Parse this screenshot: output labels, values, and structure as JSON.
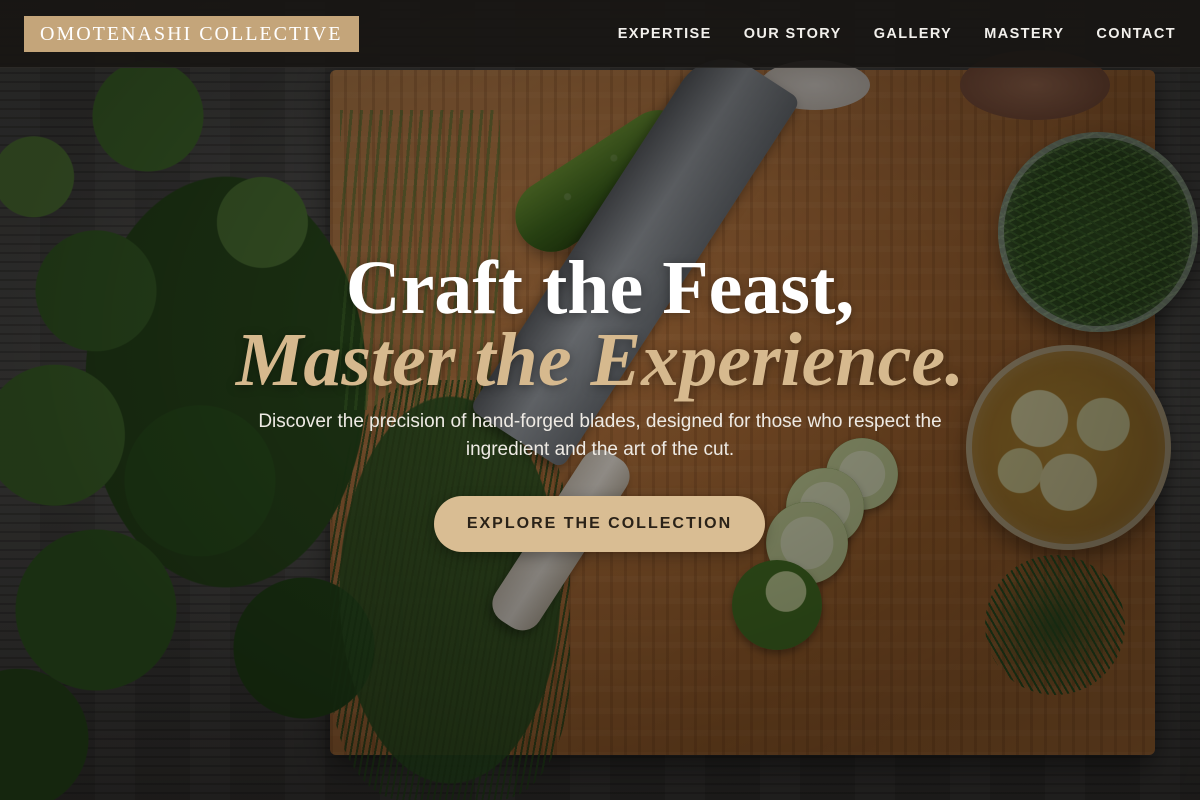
{
  "brand": {
    "logo_text": "OMOTENASHI COLLECTIVE",
    "accent_color": "#c4a57a"
  },
  "nav": {
    "items": [
      {
        "label": "EXPERTISE"
      },
      {
        "label": "OUR STORY"
      },
      {
        "label": "GALLERY"
      },
      {
        "label": "MASTERY"
      },
      {
        "label": "CONTACT"
      }
    ]
  },
  "hero": {
    "headline_line1": "Craft the Feast,",
    "headline_line2": "Master the Experience.",
    "subtitle": "Discover the precision of hand-forged blades, designed for those who respect the ingredient and the art of the cut.",
    "cta_label": "EXPLORE THE COLLECTION",
    "cta_color": "#d9bd93",
    "headline_accent_color": "#d6b98e"
  }
}
